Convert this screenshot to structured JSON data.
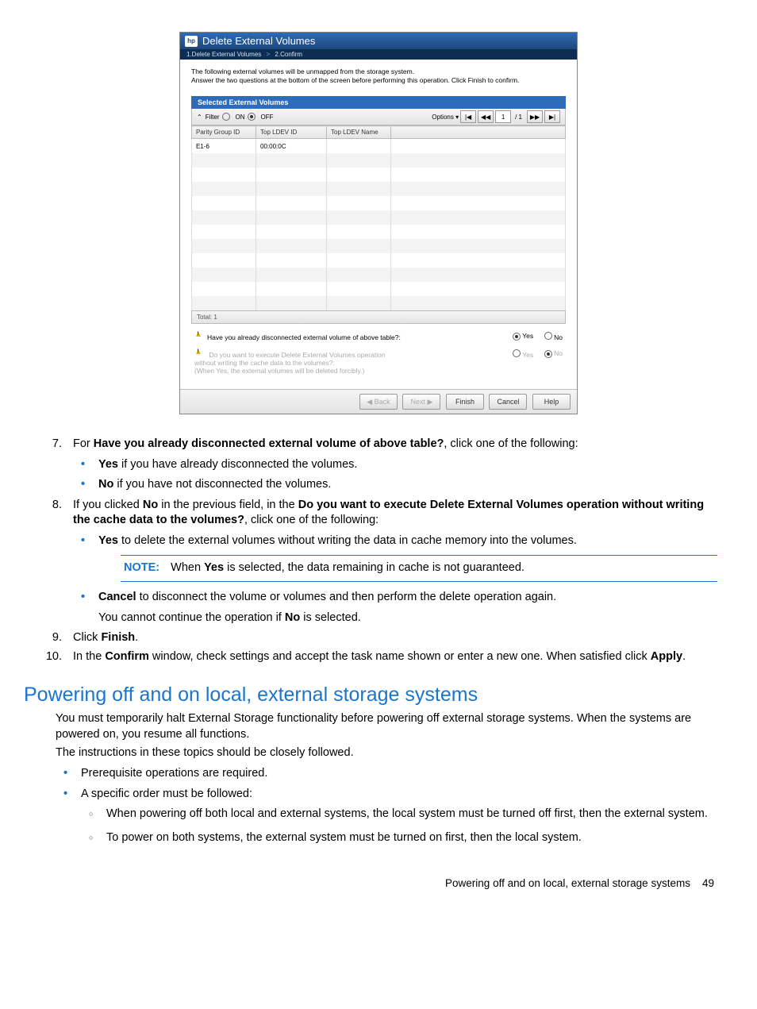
{
  "screenshot": {
    "logo_text": "hp",
    "title": "Delete External Volumes",
    "breadcrumb": {
      "step1": "1.Delete External Volumes",
      "sep": ">",
      "step2": "2.Confirm"
    },
    "intro_line1": "The following external volumes will be unmapped from the storage system.",
    "intro_line2": "Answer the two questions at the bottom of the screen before performing this operation. Click Finish to confirm.",
    "subhead": "Selected External Volumes",
    "toolbar": {
      "filter_icon": "⌃",
      "filter_label": "Filter",
      "on_label": "ON",
      "off_label": "OFF",
      "options_label": "Options",
      "options_arrow": "▾",
      "first": "|◀",
      "prev": "◀◀",
      "page": "1",
      "page_sep": "/ 1",
      "next": "▶▶",
      "last": "▶|"
    },
    "cols": {
      "c1": "Parity Group ID",
      "c2": "Top LDEV ID",
      "c3": "Top LDEV Name"
    },
    "row": {
      "c1": "E1-6",
      "c2": "00:00:0C",
      "c3": ""
    },
    "total": "Total: 1",
    "q1": {
      "text": "Have you already disconnected external volume of above table?:",
      "yes": "Yes",
      "no": "No"
    },
    "q2": {
      "line1": "Do you want to execute Delete External Volumes operation",
      "line2": "without writing the cache data to the volumes?:",
      "line3": "(When Yes, the external volumes will be deleted forcibly.)",
      "yes": "Yes",
      "no": "No"
    },
    "buttons": {
      "back": "◀ Back",
      "next": "Next ▶",
      "finish": "Finish",
      "cancel": "Cancel",
      "help": "Help"
    }
  },
  "doc": {
    "step7": {
      "lead": "For ",
      "bold": "Have you already disconnected external volume of above table?",
      "tail": ", click one of the following:",
      "yes_bold": "Yes",
      "yes_tail": " if you have already disconnected the volumes.",
      "no_bold": "No",
      "no_tail": " if you have not disconnected the volumes."
    },
    "step8": {
      "lead": "If you clicked ",
      "b1": "No",
      "mid1": " in the previous field, in the ",
      "b2": "Do you want to execute Delete External Volumes operation without writing the cache data to the volumes?",
      "tail": ", click one of the following:",
      "yes_bold": "Yes",
      "yes_tail": " to delete the external volumes without writing the data in cache memory into the volumes.",
      "note_label": "NOTE:",
      "note_lead": "When ",
      "note_bold": "Yes",
      "note_tail": " is selected, the data remaining in cache is not guaranteed.",
      "cancel_bold": "Cancel",
      "cancel_tail": " to disconnect the volume or volumes and then perform the delete operation again.",
      "cancel_extra_lead": "You cannot continue the operation if ",
      "cancel_extra_bold": "No",
      "cancel_extra_tail": " is selected."
    },
    "step9": {
      "lead": "Click ",
      "bold": "Finish",
      "tail": "."
    },
    "step10": {
      "lead": "In the ",
      "b1": "Confirm",
      "mid": " window, check settings and accept the task name shown or enter a new one. When satisfied click ",
      "b2": "Apply",
      "tail": "."
    },
    "section_title": "Powering off and on local, external storage systems",
    "para1": "You must temporarily halt External Storage functionality before powering off external storage systems. When the systems are powered on, you resume all functions.",
    "para2": "The instructions in these topics should be closely followed.",
    "bul1": "Prerequisite operations are required.",
    "bul2": "A specific order must be followed:",
    "sub1": "When powering off both local and external systems, the local system must be turned off first, then the external system.",
    "sub2": "To power on both systems, the external system must be turned on first, then the local system.",
    "footer_text": "Powering off and on local, external storage systems",
    "footer_page": "49"
  }
}
